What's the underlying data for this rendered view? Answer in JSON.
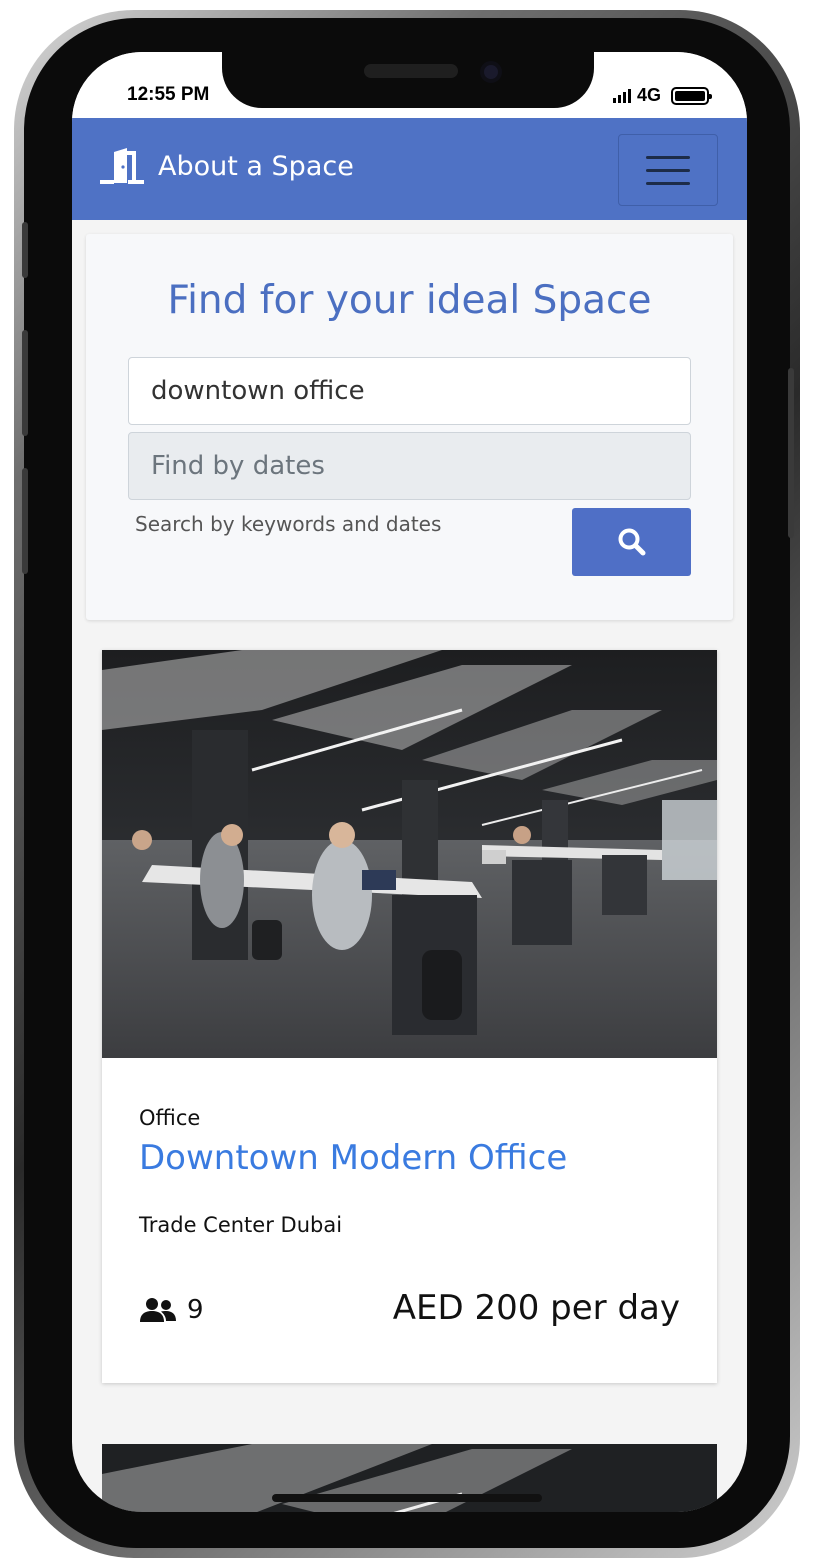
{
  "status_bar": {
    "time": "12:55 PM",
    "network": "4G"
  },
  "navbar": {
    "brand": "About a Space",
    "brand_icon": "door-icon",
    "menu_icon": "hamburger-icon"
  },
  "search": {
    "title": "Find for your ideal Space",
    "keyword_value": "downtown office",
    "dates_placeholder": "Find by dates",
    "helper": "Search by keywords and dates",
    "button_icon": "search-icon"
  },
  "listings": [
    {
      "type": "Office",
      "title": "Downtown Modern Office",
      "location": "Trade Center Dubai",
      "capacity": "9",
      "price": "AED 200 per day",
      "capacity_icon": "users-icon"
    }
  ],
  "colors": {
    "primary": "#4f72c5",
    "link": "#3a7be0",
    "title": "#4b6fc1"
  }
}
